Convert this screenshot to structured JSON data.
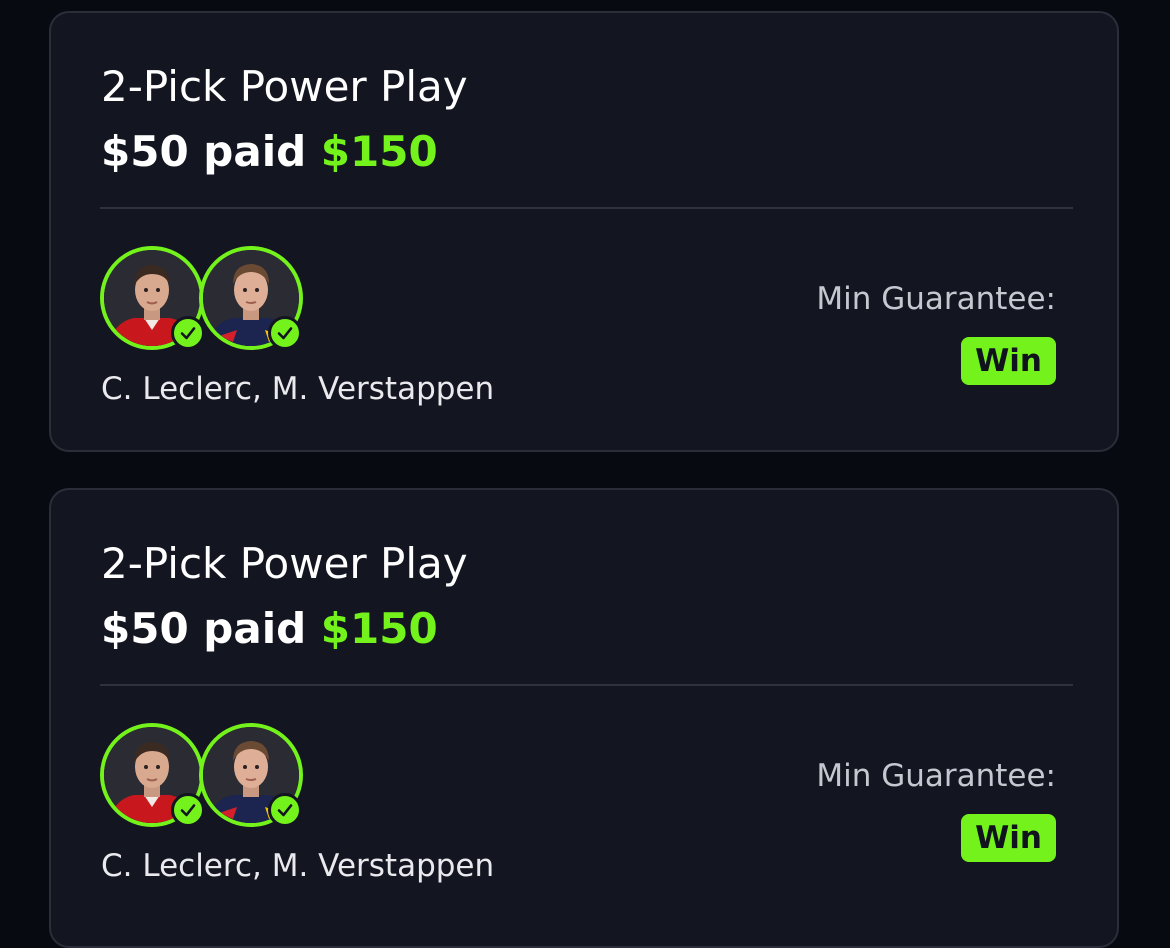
{
  "entries": [
    {
      "title": "2-Pick Power Play",
      "paid": "$50 paid",
      "payout": "$150",
      "picks": "C. Leclerc, M. Verstappen",
      "guarantee_label": "Min Guarantee:",
      "result": "Win",
      "players": [
        {
          "avatar": "leclerc-headshot",
          "status_icon": "check-icon"
        },
        {
          "avatar": "verstappen-headshot",
          "status_icon": "check-icon"
        }
      ]
    },
    {
      "title": "2-Pick Power Play",
      "paid": "$50 paid",
      "payout": "$150",
      "picks": "C. Leclerc, M. Verstappen",
      "guarantee_label": "Min Guarantee:",
      "result": "Win",
      "players": [
        {
          "avatar": "leclerc-headshot",
          "status_icon": "check-icon"
        },
        {
          "avatar": "verstappen-headshot",
          "status_icon": "check-icon"
        }
      ]
    }
  ],
  "colors": {
    "background": "#080a12",
    "card": "#131520",
    "accent_green": "#74f21c",
    "text": "#ffffff",
    "muted_text": "#c6c8d0"
  }
}
